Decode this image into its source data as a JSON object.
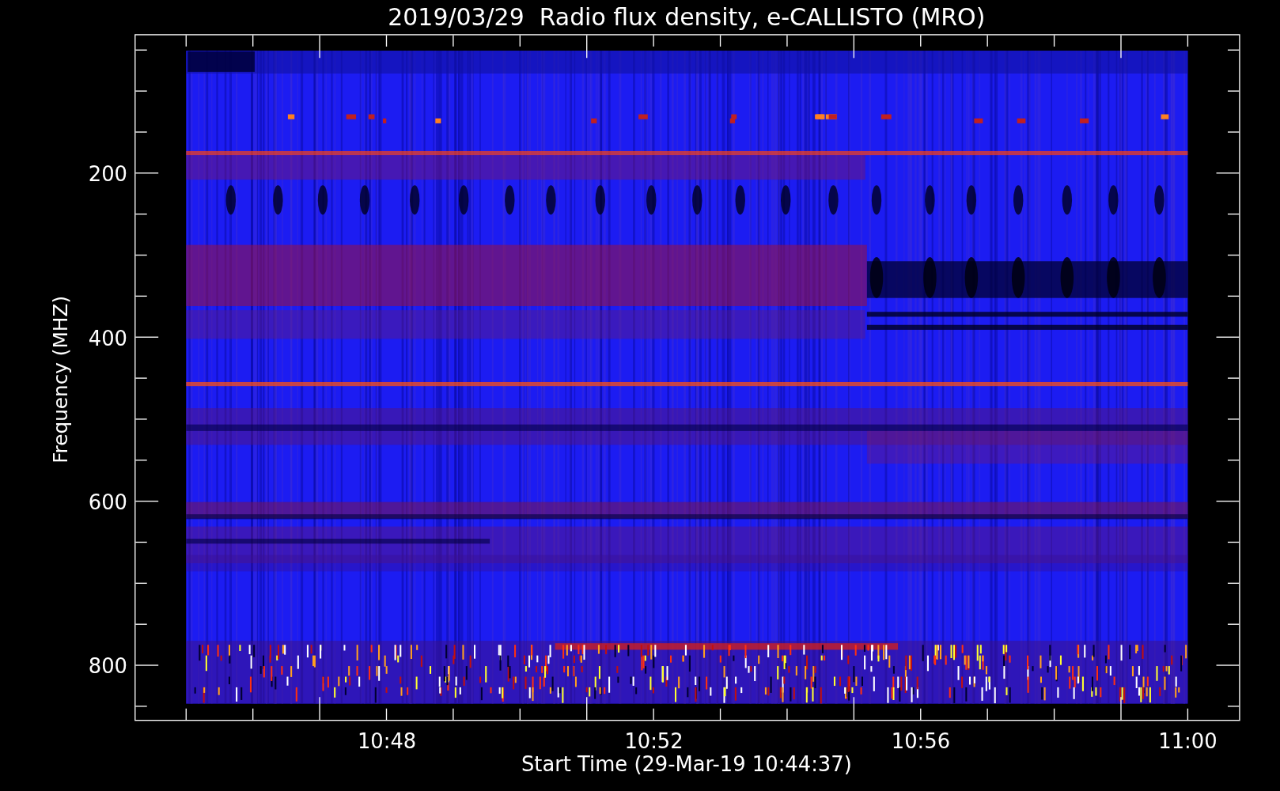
{
  "title": "2019/03/29  Radio flux density, e-CALLISTO (MRO)",
  "y_axis": {
    "label": "Frequency (MHZ)",
    "ticks": [
      "200",
      "400",
      "600",
      "800"
    ]
  },
  "x_axis": {
    "label": "Start Time (29-Mar-19 10:44:37)",
    "ticks": [
      "10:48",
      "10:52",
      "10:56",
      "11:00"
    ]
  }
}
